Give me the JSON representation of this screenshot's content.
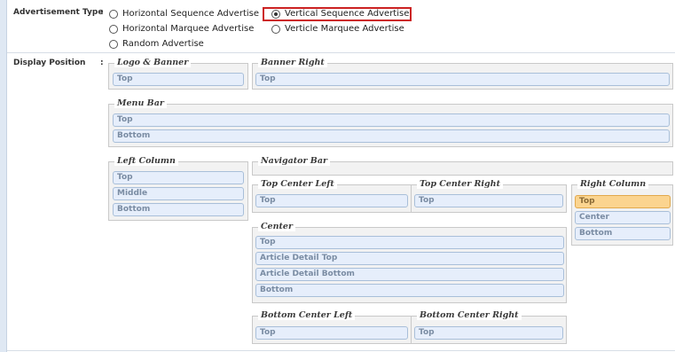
{
  "advertisement_type": {
    "label": "Advertisement Type",
    "colon": ":",
    "options": [
      {
        "label": "Horizontal Sequence Advertise",
        "checked": false
      },
      {
        "label": "Vertical Sequence Advertise",
        "checked": true
      },
      {
        "label": "Horizontal Marquee Advertise",
        "checked": false
      },
      {
        "label": "Verticle Marquee Advertise",
        "checked": false
      },
      {
        "label": "Random Advertise",
        "checked": false
      }
    ]
  },
  "display_position": {
    "label": "Display Position",
    "colon": ":",
    "groups": {
      "logo_banner": {
        "legend": "Logo & Banner",
        "slots": [
          "Top"
        ]
      },
      "banner_right": {
        "legend": "Banner Right",
        "slots": [
          "Top"
        ]
      },
      "menu_bar": {
        "legend": "Menu Bar",
        "slots": [
          "Top",
          "Bottom"
        ]
      },
      "left_column": {
        "legend": "Left Column",
        "slots": [
          "Top",
          "Middle",
          "Bottom"
        ]
      },
      "navigator_bar": {
        "legend": "Navigator Bar",
        "slots": []
      },
      "top_center_left": {
        "legend": "Top Center Left",
        "slots": [
          "Top"
        ]
      },
      "top_center_right": {
        "legend": "Top Center Right",
        "slots": [
          "Top"
        ]
      },
      "right_column": {
        "legend": "Right Column",
        "slots": [
          "Top",
          "Center",
          "Bottom"
        ],
        "highlighted": "Top"
      },
      "center": {
        "legend": "Center",
        "slots": [
          "Top",
          "Article Detail Top",
          "Article Detail Bottom",
          "Bottom"
        ]
      },
      "bottom_center_left": {
        "legend": "Bottom Center Left",
        "slots": [
          "Top"
        ]
      },
      "bottom_center_right": {
        "legend": "Bottom Center Right",
        "slots": [
          "Top"
        ]
      }
    }
  },
  "colors": {
    "selection_border": "#cc2222",
    "highlight_slot": "#fbd48f",
    "slot_fill": "#e6eefb"
  }
}
